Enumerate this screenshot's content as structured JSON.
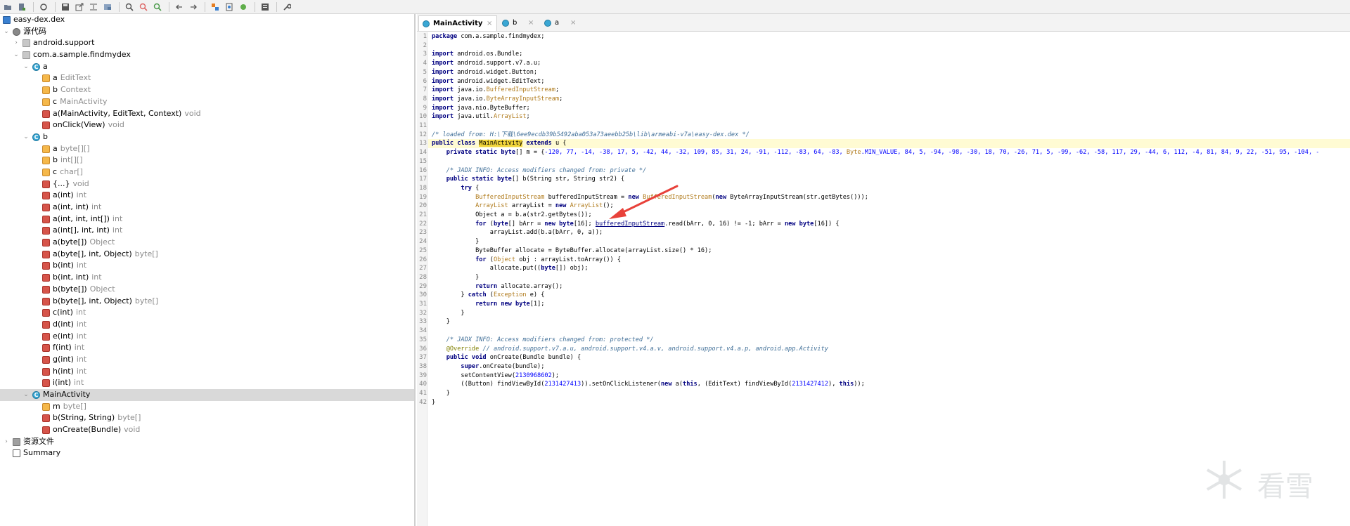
{
  "toolbar": {
    "buttons": [
      "open-icon",
      "add-icon",
      "reload-icon",
      "save-icon",
      "export-icon",
      "flatten-icon",
      "package-icon",
      "search-icon",
      "find-class-icon",
      "find-usage-icon",
      "back-icon",
      "forward-icon",
      "sync-icon",
      "deobfuscation-icon",
      "log-icon",
      "settings-icon",
      "preferences-icon"
    ]
  },
  "tree": {
    "root": "easy-dex.dex",
    "source_code": "源代码",
    "android_support": "android.support",
    "package": "com.a.sample.findmydex",
    "class_a": "a",
    "a_fields": [
      {
        "name": "a",
        "type": "EditText"
      },
      {
        "name": "b",
        "type": "Context"
      },
      {
        "name": "c",
        "type": "MainActivity"
      }
    ],
    "a_methods": [
      {
        "name": "a(MainActivity, EditText, Context)",
        "type": "void"
      },
      {
        "name": "onClick(View)",
        "type": "void"
      }
    ],
    "class_b": "b",
    "b_fields": [
      {
        "name": "a",
        "type": "byte[][]"
      },
      {
        "name": "b",
        "type": "int[][]"
      },
      {
        "name": "c",
        "type": "char[]"
      }
    ],
    "b_methods": [
      {
        "name": "{...}",
        "type": "void"
      },
      {
        "name": "a(int)",
        "type": "int"
      },
      {
        "name": "a(int, int)",
        "type": "int"
      },
      {
        "name": "a(int, int, int[])",
        "type": "int"
      },
      {
        "name": "a(int[], int, int)",
        "type": "int"
      },
      {
        "name": "a(byte[])",
        "type": "Object"
      },
      {
        "name": "a(byte[], int, Object)",
        "type": "byte[]"
      },
      {
        "name": "b(int)",
        "type": "int"
      },
      {
        "name": "b(int, int)",
        "type": "int"
      },
      {
        "name": "b(byte[])",
        "type": "Object"
      },
      {
        "name": "b(byte[], int, Object)",
        "type": "byte[]"
      },
      {
        "name": "c(int)",
        "type": "int"
      },
      {
        "name": "d(int)",
        "type": "int"
      },
      {
        "name": "e(int)",
        "type": "int"
      },
      {
        "name": "f(int)",
        "type": "int"
      },
      {
        "name": "g(int)",
        "type": "int"
      },
      {
        "name": "h(int)",
        "type": "int"
      },
      {
        "name": "i(int)",
        "type": "int"
      }
    ],
    "class_main": "MainActivity",
    "main_members": [
      {
        "name": "m",
        "type": "byte[]",
        "kind": "field"
      },
      {
        "name": "b(String, String)",
        "type": "byte[]",
        "kind": "method"
      },
      {
        "name": "onCreate(Bundle)",
        "type": "void",
        "kind": "method"
      }
    ],
    "resources": "资源文件",
    "summary": "Summary"
  },
  "tabs": [
    {
      "label": "MainActivity",
      "active": true
    },
    {
      "label": "b",
      "active": false
    },
    {
      "label": "a",
      "active": false
    }
  ],
  "code": {
    "line_numbers": [
      "1",
      "2",
      "3",
      "4",
      "5",
      "6",
      "7",
      "8",
      "9",
      "10",
      "11",
      "12",
      "13",
      "14",
      "15",
      "16",
      "17",
      "18",
      "19",
      "20",
      "21",
      "22",
      "23",
      "24",
      "25",
      "26",
      "27",
      "28",
      "29",
      "30",
      "31",
      "32",
      "33",
      "34",
      "35",
      "36",
      "37",
      "38",
      "39",
      "40",
      "41",
      "42"
    ],
    "l1_kw": "package",
    "l1_rest": " com.a.sample.findmydex;",
    "imp": "import",
    "l3": " android.os.Bundle;",
    "l4": " android.support.v7.a.u;",
    "l5": " android.widget.Button;",
    "l6": " android.widget.EditText;",
    "l7_a": " java.io.",
    "l7_t": "BufferedInputStream",
    "l7_b": ";",
    "l8_a": " java.io.",
    "l8_t": "ByteArrayInputStream",
    "l8_b": ";",
    "l9": " java.nio.ByteBuffer;",
    "l10_a": " java.util.",
    "l10_t": "ArrayList",
    "l10_b": ";",
    "l12": "/* loaded from: H:\\下载\\6ee9ecdb39b5492aba053a73aeebb25b\\lib\\armeabi-v7a\\easy-dex.dex */",
    "l13_kw": "public class ",
    "l13_match": "MainActivity",
    "l13_kw2": " extends",
    "l13_rest": " u {",
    "l14_kw": "    private static ",
    "l14_t": "byte",
    "l14_a": "[] m = {",
    "l14_vals": "-120, 77, -14, -38, 17, 5, -42, 44, -32, 109, 85, 31, 24, -91, -112, -83, 64, -83, ",
    "l14_const": "Byte",
    "l14_tail": ".MIN_VALUE, 84, 5, -94, -98, -30, 18, 70, -26, 71, 5, -99, -62, -58, 117, 29, -44, 6, 112, -4, 81, 84, 9, 22, -51, 95, -104, -",
    "l16": "    /* JADX INFO: Access modifiers changed from: private */",
    "l17_kw": "    public static ",
    "l17_t": "byte",
    "l17_rest": "[] b(String str, String str2) {",
    "l18_kw": "        try",
    "l18_rest": " {",
    "l19_t": "            BufferedInputStream",
    "l19_a": " bufferedInputStream = ",
    "l19_kw": "new",
    "l19_t2": " BufferedInputStream",
    "l19_b": "(",
    "l19_kw2": "new",
    "l19_c": " ByteArrayInputStream(str.getBytes()));",
    "l20_t": "            ArrayList",
    "l20_a": " arrayList = ",
    "l20_kw": "new",
    "l20_t2": " ArrayList",
    "l20_b": "();",
    "l21": "            Object a = b.a(str2.getBytes());",
    "l22_kw": "            for",
    "l22_a": " (",
    "l22_t": "byte",
    "l22_b": "[] bArr = ",
    "l22_kw2": "new",
    "l22_t2": " byte",
    "l22_c": "[16]; ",
    "l22_u": "bufferedInputStream",
    "l22_d": ".read(bArr, 0, 16) != -1; bArr = ",
    "l22_kw3": "new",
    "l22_t3": " byte",
    "l22_e": "[16]) {",
    "l23": "                arrayList.add(b.a(bArr, 0, a));",
    "l24": "            }",
    "l25": "            ByteBuffer allocate = ByteBuffer.allocate(arrayList.size() * 16);",
    "l26_kw": "            for",
    "l26_a": " (",
    "l26_t": "Object",
    "l26_b": " obj : arrayList.toArray()) {",
    "l27_a": "                allocate.put((",
    "l27_t": "byte",
    "l27_b": "[]) obj);",
    "l28": "            }",
    "l29_kw": "            return",
    "l29_rest": " allocate.array();",
    "l30_a": "        } ",
    "l30_kw": "catch",
    "l30_b": " (",
    "l30_t": "Exception",
    "l30_c": " e) {",
    "l31_kw": "            return",
    "l31_a": " ",
    "l31_kw2": "new",
    "l31_t": " byte",
    "l31_b": "[1];",
    "l32": "        }",
    "l33": "    }",
    "l35": "    /* JADX INFO: Access modifiers changed from: protected */",
    "l36_an": "    @Override",
    "l36_cm": " // android.support.v7.a.u, android.support.v4.a.v, android.support.v4.a.p, android.app.Activity",
    "l37_kw": "    public void",
    "l37_rest": " onCreate(Bundle bundle) {",
    "l38_kw": "        super",
    "l38_rest": ".onCreate(bundle);",
    "l39_a": "        setContentView(",
    "l39_n": "2130968602",
    "l39_b": ");",
    "l40_a": "        ((Button) findViewById(",
    "l40_n": "2131427413",
    "l40_b": ")).setOnClickListener(",
    "l40_kw": "new",
    "l40_c": " a(",
    "l40_kw2": "this",
    "l40_d": ", (EditText) findViewById(",
    "l40_n2": "2131427412",
    "l40_e": "), ",
    "l40_kw3": "this",
    "l40_f": "));",
    "l41": "    }",
    "l42": "}"
  },
  "watermark": "看雪",
  "colors": {
    "keyword": "#000080",
    "comment": "#3f6e97",
    "number": "#0000ff",
    "type": "#b07a1a",
    "highlight": "#f1d43a",
    "current_line": "#fffbd3",
    "arrow": "#e8413a"
  }
}
